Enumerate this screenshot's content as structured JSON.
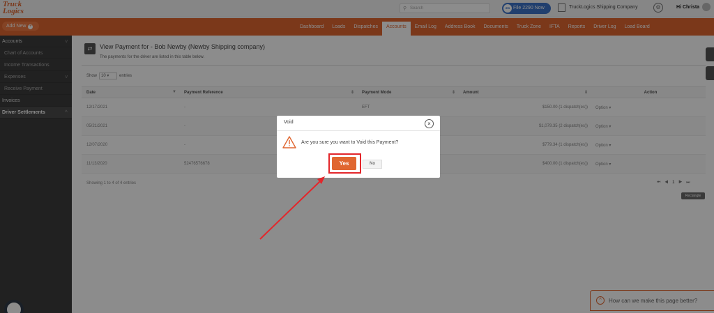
{
  "header": {
    "logo_line1": "Truck",
    "logo_line2": "Logics",
    "search_placeholder": "Search",
    "file_button": "File 2290 Now",
    "irs_badge": "IRS",
    "company": "TruckLogics Shipping Company",
    "greeting": "Hi Christa"
  },
  "nav": {
    "add_new": "Add New",
    "items": [
      "Dashboard",
      "Loads",
      "Dispatches",
      "Accounts",
      "Email Log",
      "Address Book",
      "Documents",
      "Truck Zone",
      "IFTA",
      "Reports",
      "Driver Log",
      "Load Board"
    ],
    "active_index": 3
  },
  "sidebar": {
    "items": [
      {
        "label": "Accounts",
        "type": "head"
      },
      {
        "label": "Chart of Accounts",
        "type": "sub"
      },
      {
        "label": "Income Transactions",
        "type": "sub"
      },
      {
        "label": "Expenses",
        "type": "sub"
      },
      {
        "label": "Receive Payment",
        "type": "sub"
      },
      {
        "label": "Invoices",
        "type": "head"
      },
      {
        "label": "Driver Settlements",
        "type": "active"
      }
    ]
  },
  "page": {
    "title": "View Payment for - Bob Newby (Newby Shipping company)",
    "subtitle": "The payments for the driver are listed in this table below.",
    "show_label": "Show",
    "show_value": "10",
    "entries_label": "entries",
    "showing_text": "Showing 1 to 4 of 4 entries",
    "tooltip": "Rectangle"
  },
  "table": {
    "columns": [
      "Date",
      "Payment Reference",
      "Payment Mode",
      "Amount",
      "Action"
    ],
    "rows": [
      {
        "date": "12/17/2021",
        "ref": "-",
        "mode": "EFT",
        "amount": "$150.00 (1 dispatch(es))",
        "action": "Option"
      },
      {
        "date": "05/21/2021",
        "ref": "-",
        "mode": "",
        "amount": "$1,079.35 (2 dispatch(es))",
        "action": "Option"
      },
      {
        "date": "12/07/2020",
        "ref": "-",
        "mode": "",
        "amount": "$779.34 (1 dispatch(es))",
        "action": "Option"
      },
      {
        "date": "11/13/2020",
        "ref": "52476576678",
        "mode": "",
        "amount": "$400.00 (1 dispatch(es))",
        "action": "Option"
      }
    ]
  },
  "modal": {
    "title": "Void",
    "message": "Are you sure you want to Void this Payment?",
    "yes": "Yes",
    "no": "No"
  },
  "feedback": "How can we make this page better?",
  "colors": {
    "brand": "#e06630",
    "highlight": "#e3262b",
    "sidebar": "#3d3d3d"
  }
}
